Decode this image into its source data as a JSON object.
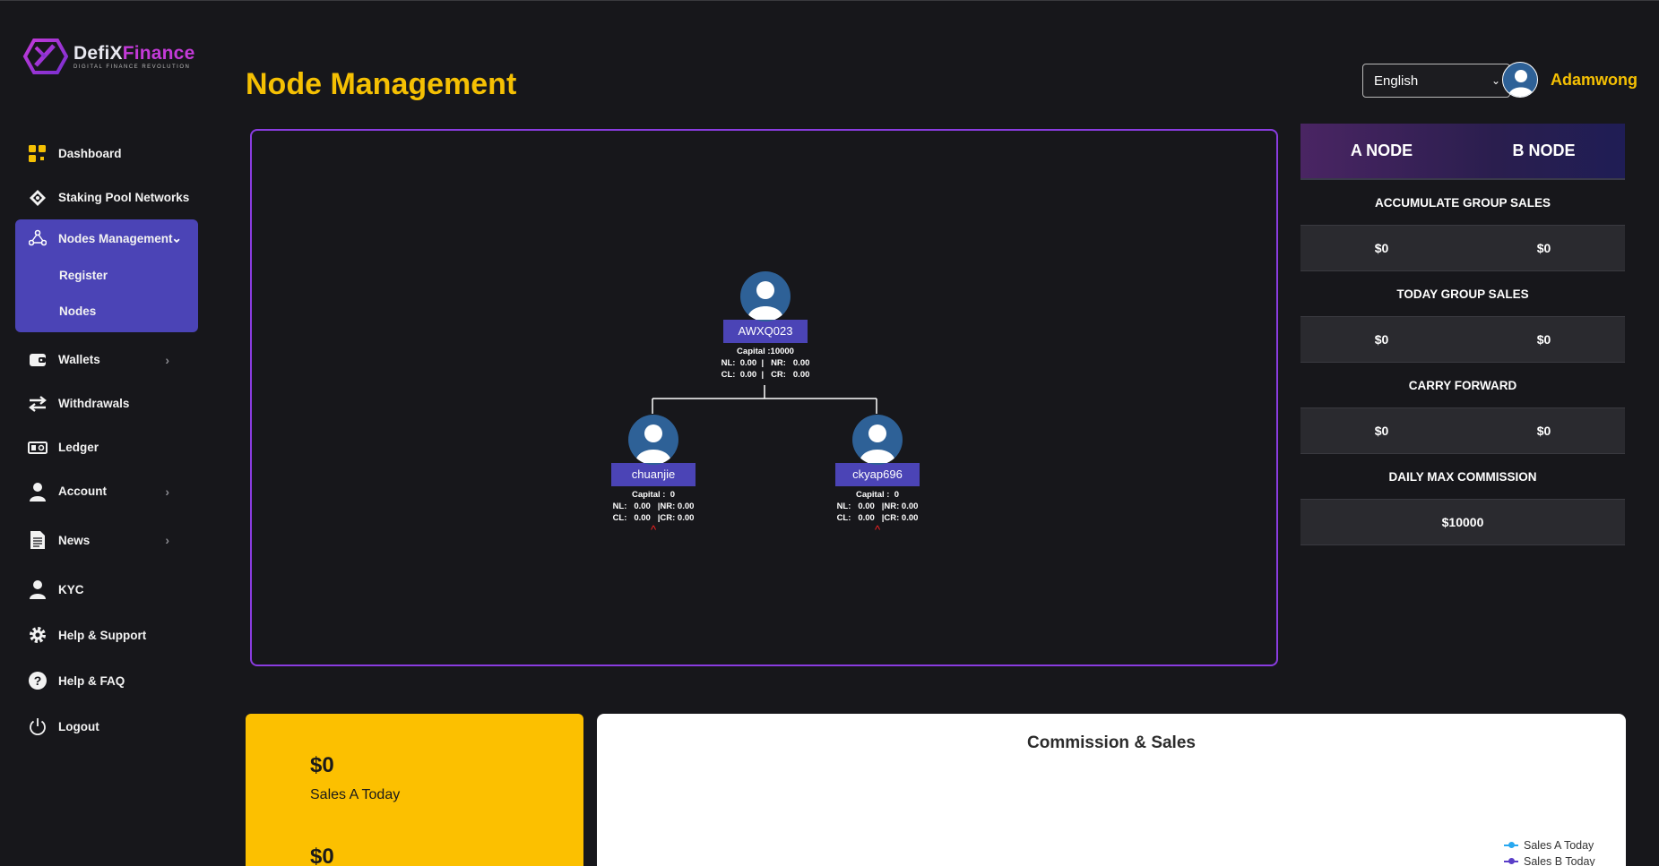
{
  "brand": {
    "name_part1": "DefiX",
    "name_part2": "Finance",
    "tagline": "DIGITAL FINANCE REVOLUTION"
  },
  "sidebar": {
    "items": [
      {
        "label": "Dashboard",
        "icon": "dashboard-icon"
      },
      {
        "label": "Staking Pool Networks",
        "icon": "network-icon"
      },
      {
        "label": "Nodes Management",
        "icon": "nodes-icon",
        "expanded": true,
        "children": [
          {
            "label": "Register"
          },
          {
            "label": "Nodes"
          }
        ]
      },
      {
        "label": "Wallets",
        "icon": "wallet-icon"
      },
      {
        "label": "Withdrawals",
        "icon": "transfer-icon"
      },
      {
        "label": "Ledger",
        "icon": "ledger-icon"
      },
      {
        "label": "Account",
        "icon": "user-icon"
      },
      {
        "label": "News",
        "icon": "document-icon"
      },
      {
        "label": "KYC",
        "icon": "user-icon"
      },
      {
        "label": "Help & Support",
        "icon": "gear-icon"
      },
      {
        "label": "Help & FAQ",
        "icon": "question-icon"
      },
      {
        "label": "Logout",
        "icon": "power-icon"
      }
    ]
  },
  "header": {
    "title": "Node Management",
    "language": "English",
    "username": "Adamwong"
  },
  "tree": {
    "root": {
      "name": "AWXQ023",
      "capital_label": "Capital :",
      "capital": "10000",
      "nl": "0.00",
      "nr": "0.00",
      "cl": "0.00",
      "cr": "0.00"
    },
    "left": {
      "name": "chuanjie",
      "capital_label": "Capital :",
      "capital": "0",
      "nl": "0.00",
      "nr": "0.00",
      "cl": "0.00",
      "cr": "0.00",
      "arrow": "^"
    },
    "right": {
      "name": "ckyap696",
      "capital_label": "Capital :",
      "capital": "0",
      "nl": "0.00",
      "nr": "0.00",
      "cl": "0.00",
      "cr": "0.00",
      "arrow": "^"
    }
  },
  "summary": {
    "a_node": "A NODE",
    "b_node": "B NODE",
    "accumulate_title": "ACCUMULATE GROUP SALES",
    "accumulate_a": "$0",
    "accumulate_b": "$0",
    "today_title": "TODAY GROUP SALES",
    "today_a": "$0",
    "today_b": "$0",
    "carry_title": "CARRY FORWARD",
    "carry_a": "$0",
    "carry_b": "$0",
    "daily_max_title": "DAILY MAX COMMISSION",
    "daily_max": "$10000"
  },
  "sales_card": {
    "a_amount": "$0",
    "a_label": "Sales A Today",
    "b_amount": "$0"
  },
  "chart": {
    "title": "Commission & Sales",
    "legend": [
      {
        "name": "Sales A Today",
        "color": "#29a8f0"
      },
      {
        "name": "Sales B Today",
        "color": "#5a3ec8"
      }
    ]
  },
  "colors": {
    "accent_yellow": "#f5c003",
    "accent_purple": "#4b44b6",
    "border_purple": "#8a3ce0"
  }
}
